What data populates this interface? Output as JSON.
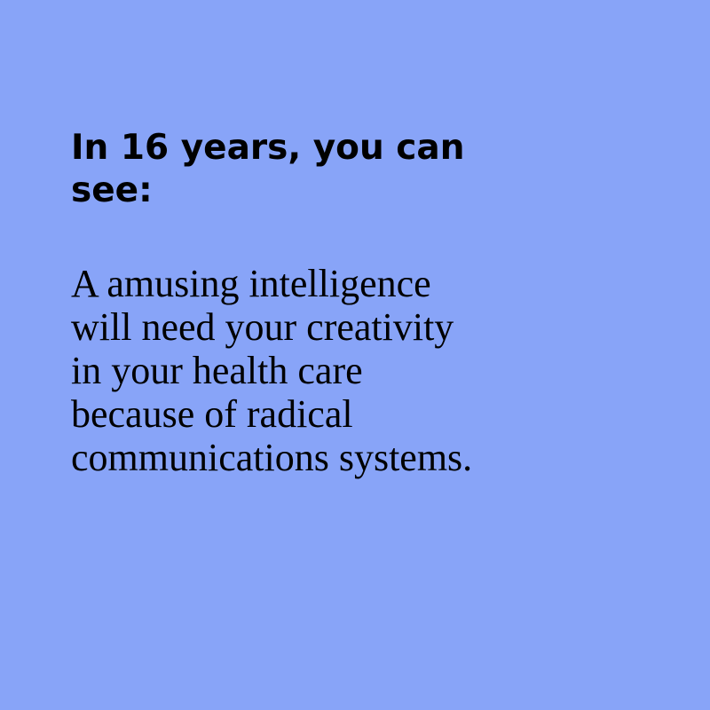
{
  "headline": {
    "lines": [
      "In 16 years, you can",
      "see:"
    ]
  },
  "body": {
    "lines": [
      "A amusing intelligence",
      "will need your creativity",
      "in your health care",
      "because of radical",
      "communications systems."
    ]
  },
  "colors": {
    "background": "#88a4f8",
    "text": "#000000"
  }
}
